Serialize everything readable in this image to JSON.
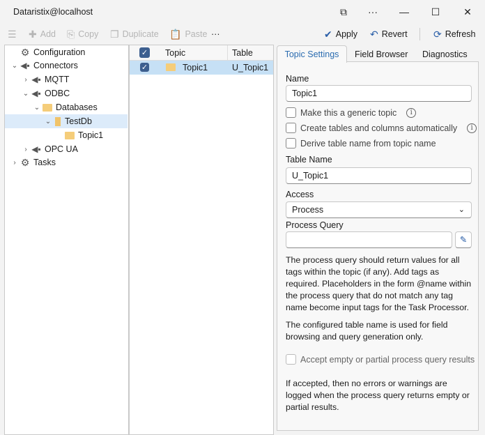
{
  "window": {
    "title": "Dataristix@localhost"
  },
  "toolbar": {
    "add": "Add",
    "copy": "Copy",
    "duplicate": "Duplicate",
    "paste": "Paste",
    "more": "···",
    "apply": "Apply",
    "revert": "Revert",
    "refresh": "Refresh"
  },
  "tree": {
    "items": [
      {
        "label": "Configuration"
      },
      {
        "label": "Connectors"
      },
      {
        "label": "MQTT"
      },
      {
        "label": "ODBC"
      },
      {
        "label": "Databases"
      },
      {
        "label": "TestDb"
      },
      {
        "label": "Topic1"
      },
      {
        "label": "OPC UA"
      },
      {
        "label": "Tasks"
      }
    ]
  },
  "grid": {
    "headers": {
      "topic": "Topic",
      "table": "Table"
    },
    "rows": [
      {
        "topic": "Topic1",
        "table": "U_Topic1",
        "checked": true
      }
    ]
  },
  "tabs": [
    "Topic Settings",
    "Field Browser",
    "Diagnostics"
  ],
  "form": {
    "name_label": "Name",
    "name_value": "Topic1",
    "generic": "Make this a generic topic",
    "create_tables": "Create tables and columns automatically",
    "derive": "Derive table name from topic name",
    "table_name_label": "Table Name",
    "table_name_value": "U_Topic1",
    "access_label": "Access",
    "access_value": "Process",
    "process_query_label": "Process Query",
    "process_query_value": "",
    "help1": "The process query should return values for all tags within the topic (if any). Add tags as required. Placeholders in the form @name within the process query that do not match any tag name become input tags for the Task Processor.",
    "help2": "The configured table name is used for field browsing and query generation only.",
    "accept_empty": "Accept empty or partial process query results",
    "help3": "If accepted, then no errors or warnings are logged when the process query returns empty or partial results."
  }
}
